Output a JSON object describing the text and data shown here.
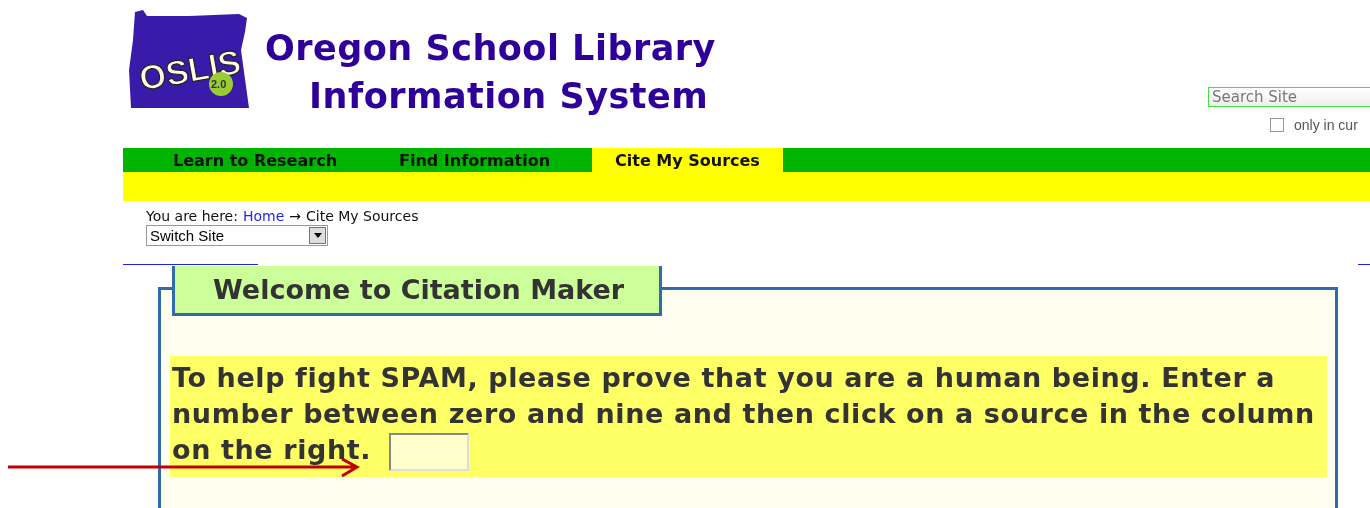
{
  "logo": {
    "text": "OSLIS",
    "version": "2.0"
  },
  "site_title": {
    "line_1": "Oregon School Library",
    "line_2": "Information System"
  },
  "search": {
    "placeholder": "Search Site",
    "scope_label": "only in cur",
    "scope_checked": false
  },
  "nav": [
    {
      "label": "Learn to Research",
      "selected": false
    },
    {
      "label": "Find Information",
      "selected": false
    },
    {
      "label": "Cite My Sources",
      "selected": true
    }
  ],
  "breadcrumb": {
    "prefix": "You are here:",
    "home": "Home",
    "separator": "→",
    "current": "Cite My Sources"
  },
  "site_switcher": {
    "value": "Switch Site"
  },
  "panel": {
    "title": "Welcome to Citation Maker",
    "message": "To help fight SPAM, please prove that you are a human being. Enter a number between zero and nine and then click on a source in the column on the right."
  },
  "annotation": {
    "kind": "arrow"
  }
}
